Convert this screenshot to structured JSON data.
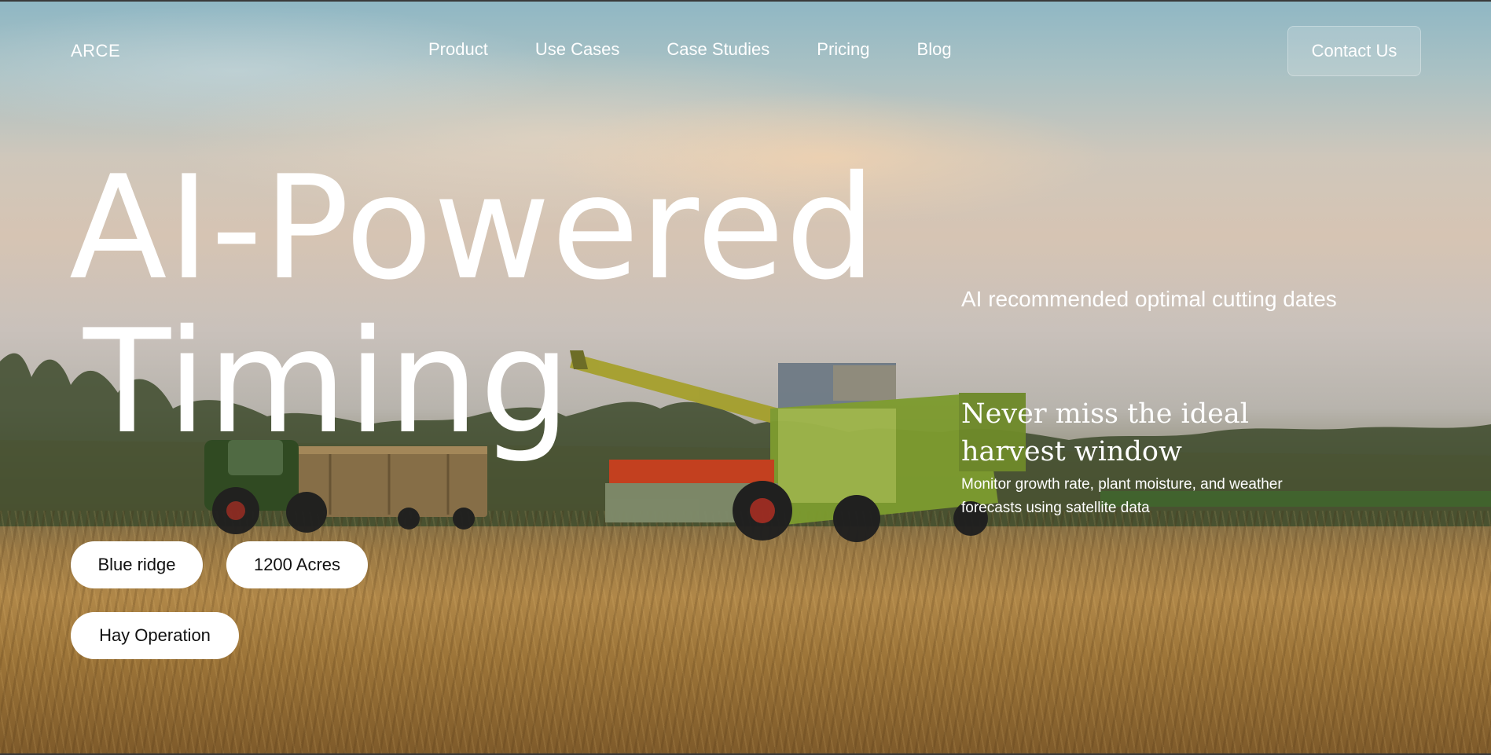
{
  "brand": {
    "name": "ARCE"
  },
  "nav": {
    "links": [
      "Product",
      "Use Cases",
      "Case Studies",
      "Pricing",
      "Blog"
    ],
    "cta": "Contact Us"
  },
  "hero": {
    "title_line1": "AI-Powered",
    "title_line2": "Timing",
    "subhead": "AI recommended optimal cutting dates",
    "feature_heading_line1": "Never miss the ideal",
    "feature_heading_line2": "harvest window",
    "feature_desc": "Monitor growth rate, plant moisture, and weather forecasts using satellite data"
  },
  "tags": [
    "Blue ridge",
    "1200 Acres",
    "Hay Operation"
  ],
  "background": {
    "scene": "wheat field harvest at sunset with combine harvester and tractor",
    "colors": {
      "sky": "#9cc0c9",
      "glow": "#f2c9a0",
      "field": "#b08748",
      "machine_green": "#8db33a"
    }
  }
}
